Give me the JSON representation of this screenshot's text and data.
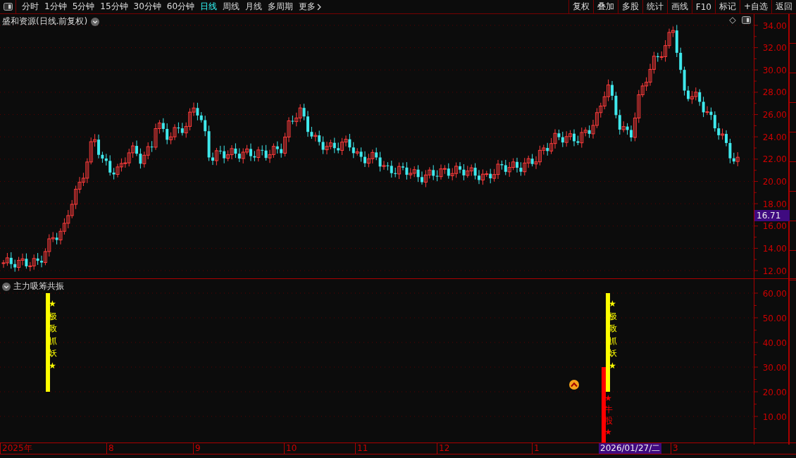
{
  "toolbar": {
    "periods": [
      {
        "label": "分时",
        "selected": false
      },
      {
        "label": "1分钟",
        "selected": false
      },
      {
        "label": "5分钟",
        "selected": false
      },
      {
        "label": "15分钟",
        "selected": false
      },
      {
        "label": "30分钟",
        "selected": false
      },
      {
        "label": "60分钟",
        "selected": false
      },
      {
        "label": "日线",
        "selected": true
      },
      {
        "label": "周线",
        "selected": false
      },
      {
        "label": "月线",
        "selected": false
      },
      {
        "label": "多周期",
        "selected": false
      },
      {
        "label": "更多",
        "selected": false
      }
    ],
    "actions": [
      "复权",
      "叠加",
      "多股",
      "统计",
      "画线",
      "F10",
      "标记",
      "+自选",
      "返回"
    ]
  },
  "main_chart": {
    "title": "盛和资源(日线.前复权)",
    "y_ticks": [
      "34.00",
      "32.00",
      "30.00",
      "28.00",
      "26.00",
      "24.00",
      "22.00",
      "20.00",
      "18.00",
      "16.00",
      "14.00",
      "12.00"
    ],
    "price_badge": "16.71"
  },
  "indicator": {
    "title": "主力吸筹共振",
    "y_ticks": [
      "60.00",
      "50.00",
      "40.00",
      "30.00",
      "20.00",
      "10.00"
    ],
    "signals": [
      {
        "kind": "yellow",
        "text": "★极致抓妖★"
      },
      {
        "kind": "yellow",
        "text": "★极致抓妖★"
      },
      {
        "kind": "red",
        "text": "★牛股★"
      }
    ]
  },
  "x_axis": {
    "labels": [
      {
        "label": "2025年",
        "selected": false
      },
      {
        "label": "8",
        "selected": false
      },
      {
        "label": "9",
        "selected": false
      },
      {
        "label": "10",
        "selected": false
      },
      {
        "label": "11",
        "selected": false
      },
      {
        "label": "12",
        "selected": false
      },
      {
        "label": "1",
        "selected": false
      },
      {
        "label": "2026/01/27/二",
        "selected": true
      },
      {
        "label": "3",
        "selected": false
      }
    ]
  }
}
